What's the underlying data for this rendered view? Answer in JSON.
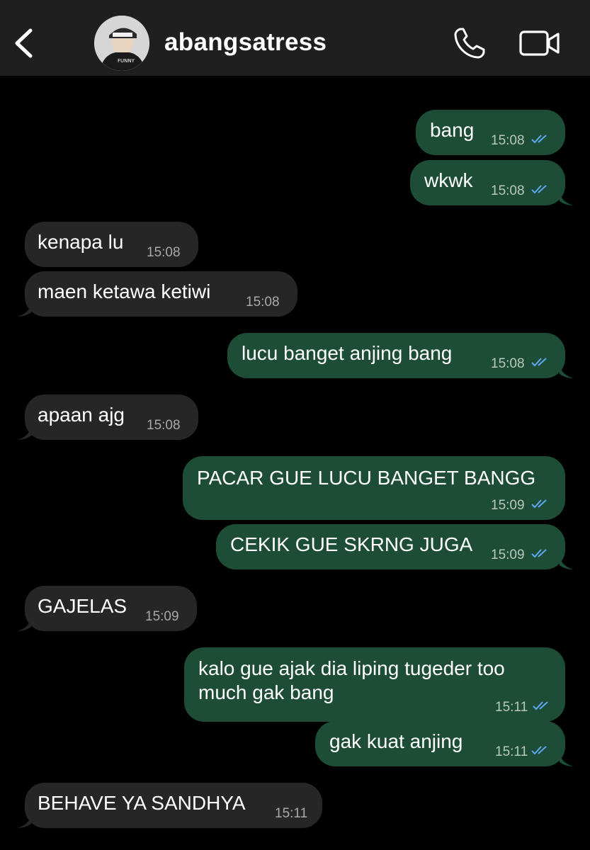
{
  "header": {
    "contact_name": "abangsatress"
  },
  "messages": [
    {
      "direction": "out",
      "text": "bang",
      "time": "15:08"
    },
    {
      "direction": "out",
      "text": "wkwk",
      "time": "15:08"
    },
    {
      "direction": "in",
      "text": "kenapa lu",
      "time": "15:08"
    },
    {
      "direction": "in",
      "text": "maen ketawa ketiwi",
      "time": "15:08"
    },
    {
      "direction": "out",
      "text": "lucu banget anjing bang",
      "time": "15:08"
    },
    {
      "direction": "in",
      "text": "apaan ajg",
      "time": "15:08"
    },
    {
      "direction": "out",
      "text": "PACAR GUE LUCU BANGET BANGG",
      "time": "15:09"
    },
    {
      "direction": "out",
      "text": "CEKIK GUE SKRNG JUGA",
      "time": "15:09"
    },
    {
      "direction": "in",
      "text": "GAJELAS",
      "time": "15:09"
    },
    {
      "direction": "out",
      "text_lines": [
        "kalo gue ajak dia liping tugeder too",
        "much gak bang"
      ],
      "time": "15:11"
    },
    {
      "direction": "out",
      "text": "gak kuat anjing",
      "time": "15:11"
    },
    {
      "direction": "in",
      "text": "BEHAVE YA SANDHYA",
      "time": "15:11"
    }
  ],
  "colors": {
    "outgoing_bubble": "#1d4d37",
    "incoming_bubble": "#262626",
    "read_ticks": "#5fa8f0",
    "header_bg": "#1f1f1f"
  },
  "icons": {
    "back": "chevron-left-icon",
    "call": "phone-icon",
    "video": "video-camera-icon",
    "read_status": "double-check-icon"
  }
}
